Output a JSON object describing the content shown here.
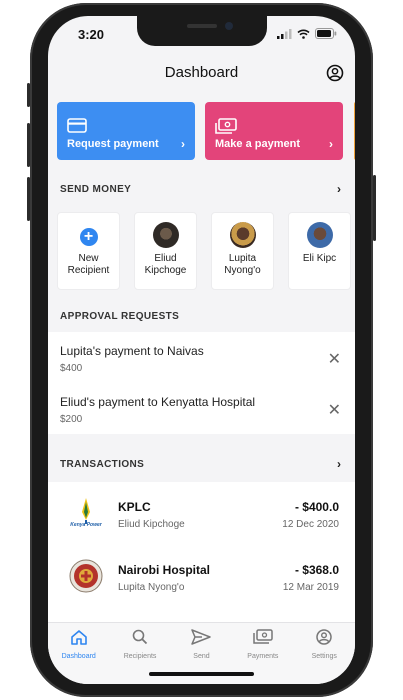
{
  "status_bar": {
    "time": "3:20"
  },
  "header": {
    "title": "Dashboard"
  },
  "actions": {
    "request": {
      "label": "Request payment",
      "chevron": "›"
    },
    "make": {
      "label": "Make a payment",
      "chevron": "›"
    }
  },
  "send_money": {
    "title": "SEND MONEY",
    "new_recipient": "New Recipient",
    "recipients": [
      {
        "name": "Eliud Kipchoge"
      },
      {
        "name": "Lupita Nyong'o"
      },
      {
        "name": "Eli Kipc"
      }
    ]
  },
  "approvals": {
    "title": "APPROVAL REQUESTS",
    "items": [
      {
        "title": "Lupita's payment to Naivas",
        "amount": "$400"
      },
      {
        "title": "Eliud's payment to Kenyatta Hospital",
        "amount": "$200"
      }
    ]
  },
  "transactions": {
    "title": "TRANSACTIONS",
    "items": [
      {
        "name": "KPLC",
        "person": "Eliud Kipchoge",
        "amount": "- $400.0",
        "date": "12 Dec 2020",
        "logo_text": "Kenya Power"
      },
      {
        "name": "Nairobi Hospital",
        "person": "Lupita Nyong'o",
        "amount": "- $368.0",
        "date": "12 Mar 2019"
      }
    ]
  },
  "tabbar": {
    "tabs": [
      {
        "label": "Dashboard",
        "icon": "home-icon"
      },
      {
        "label": "Recipients",
        "icon": "search-icon"
      },
      {
        "label": "Send",
        "icon": "send-icon"
      },
      {
        "label": "Payments",
        "icon": "payments-icon"
      },
      {
        "label": "Settings",
        "icon": "settings-icon"
      }
    ],
    "active": "Dashboard"
  },
  "colors": {
    "accent_blue": "#3d8ef2",
    "accent_pink": "#e3447a",
    "tab_active": "#2f86f0"
  }
}
